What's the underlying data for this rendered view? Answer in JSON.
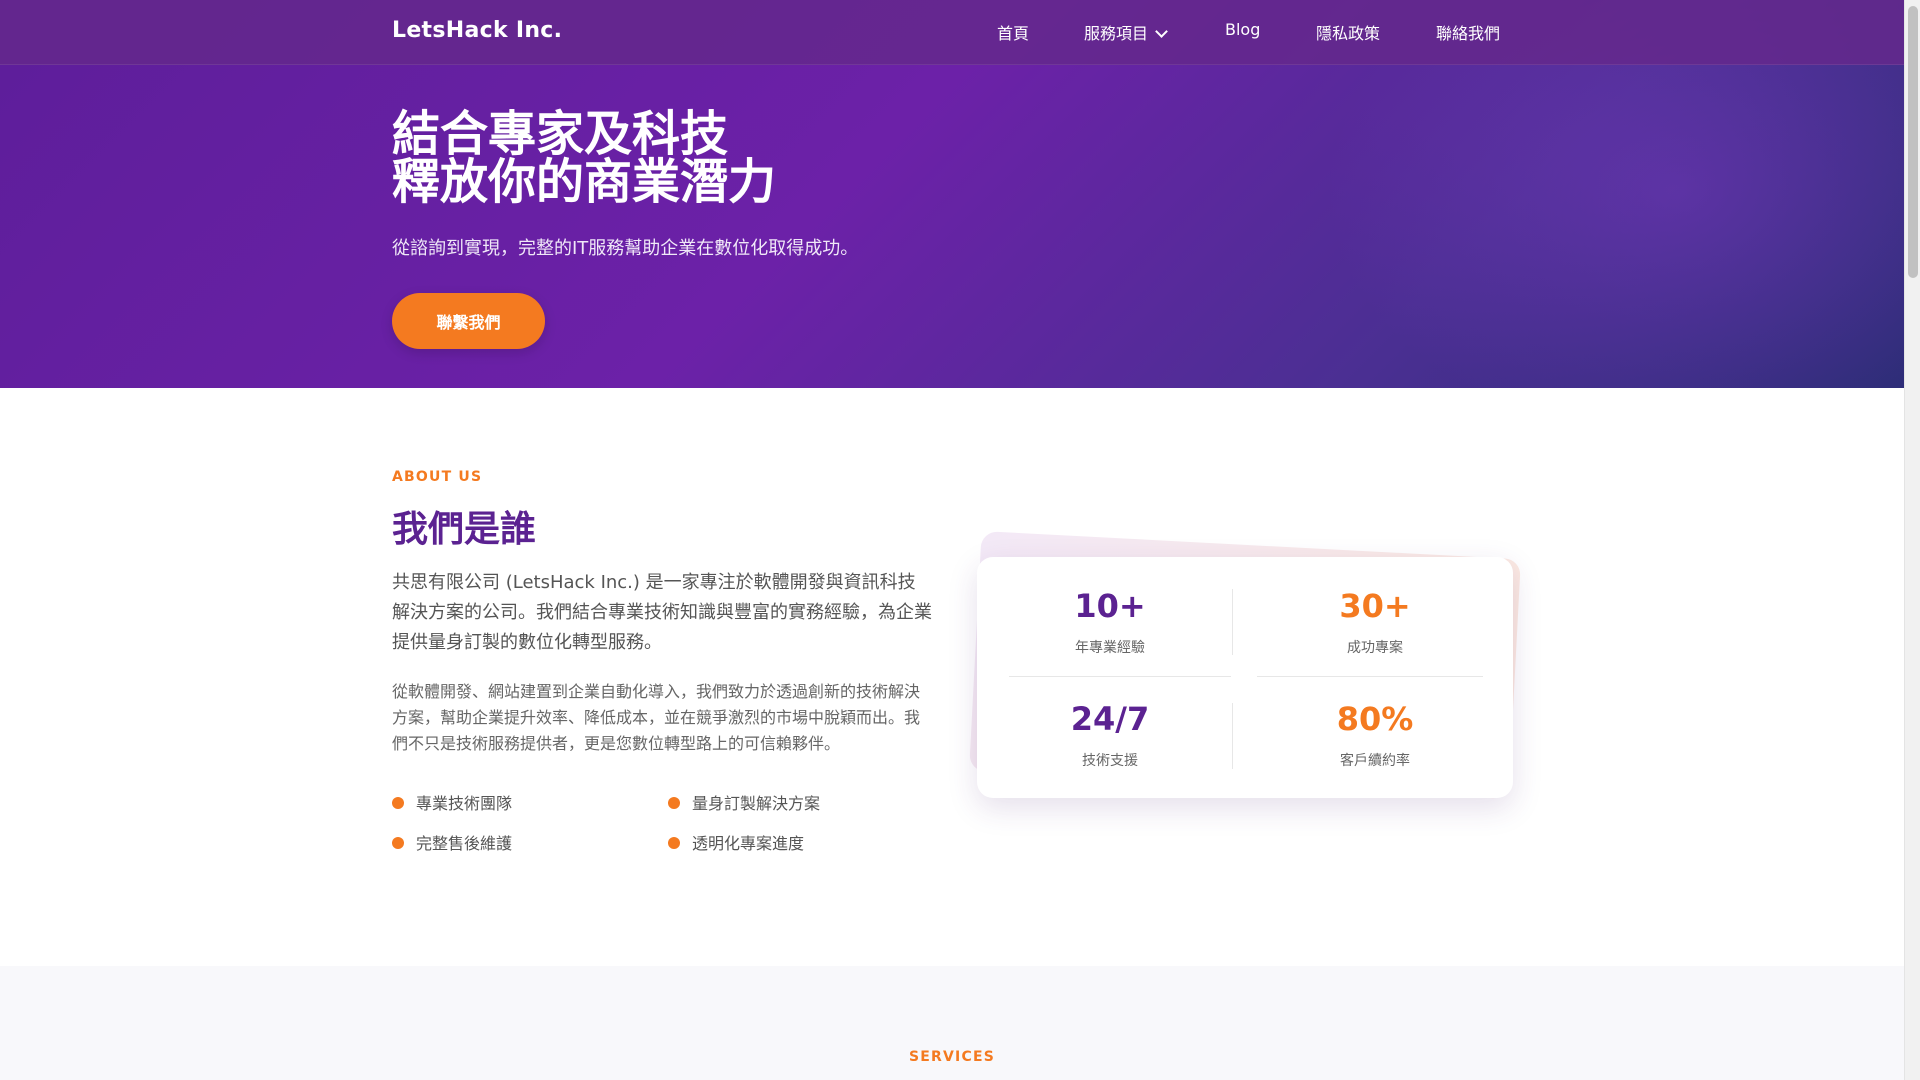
{
  "brand": "LetsHack Inc.",
  "nav": {
    "items": [
      "首頁",
      "服務項目",
      "Blog",
      "隱私政策",
      "聯絡我們"
    ]
  },
  "hero": {
    "title_line1": "結合專家及科技",
    "title_line2": "釋放你的商業潛力",
    "subtitle": "從諮詢到實現，完整的IT服務幫助企業在數位化取得成功。",
    "cta": "聯繫我們"
  },
  "about": {
    "eyebrow": "ABOUT US",
    "title": "我們是誰",
    "p1": "共思有限公司 (LetsHack Inc.) 是一家專注於軟體開發與資訊科技解決方案的公司。我們結合專業技術知識與豐富的實務經驗，為企業提供量身訂製的數位化轉型服務。",
    "p2": "從軟體開發、網站建置到企業自動化導入，我們致力於透過創新的技術解決方案，幫助企業提升效率、降低成本，並在競爭激烈的市場中脫穎而出。我們不只是技術服務提供者，更是您數位轉型路上的可信賴夥伴。",
    "features": [
      "專業技術團隊",
      "量身訂製解決方案",
      "完整售後維護",
      "透明化專案進度"
    ]
  },
  "stats": [
    {
      "value": "10+",
      "label": "年專業經驗"
    },
    {
      "value": "30+",
      "label": "成功專案"
    },
    {
      "value": "24/7",
      "label": "技術支援"
    },
    {
      "value": "80%",
      "label": "客戶續約率"
    }
  ],
  "services": {
    "eyebrow": "SERVICES"
  },
  "colors": {
    "accent": "#f47a20",
    "brand_purple": "#5b2291"
  }
}
